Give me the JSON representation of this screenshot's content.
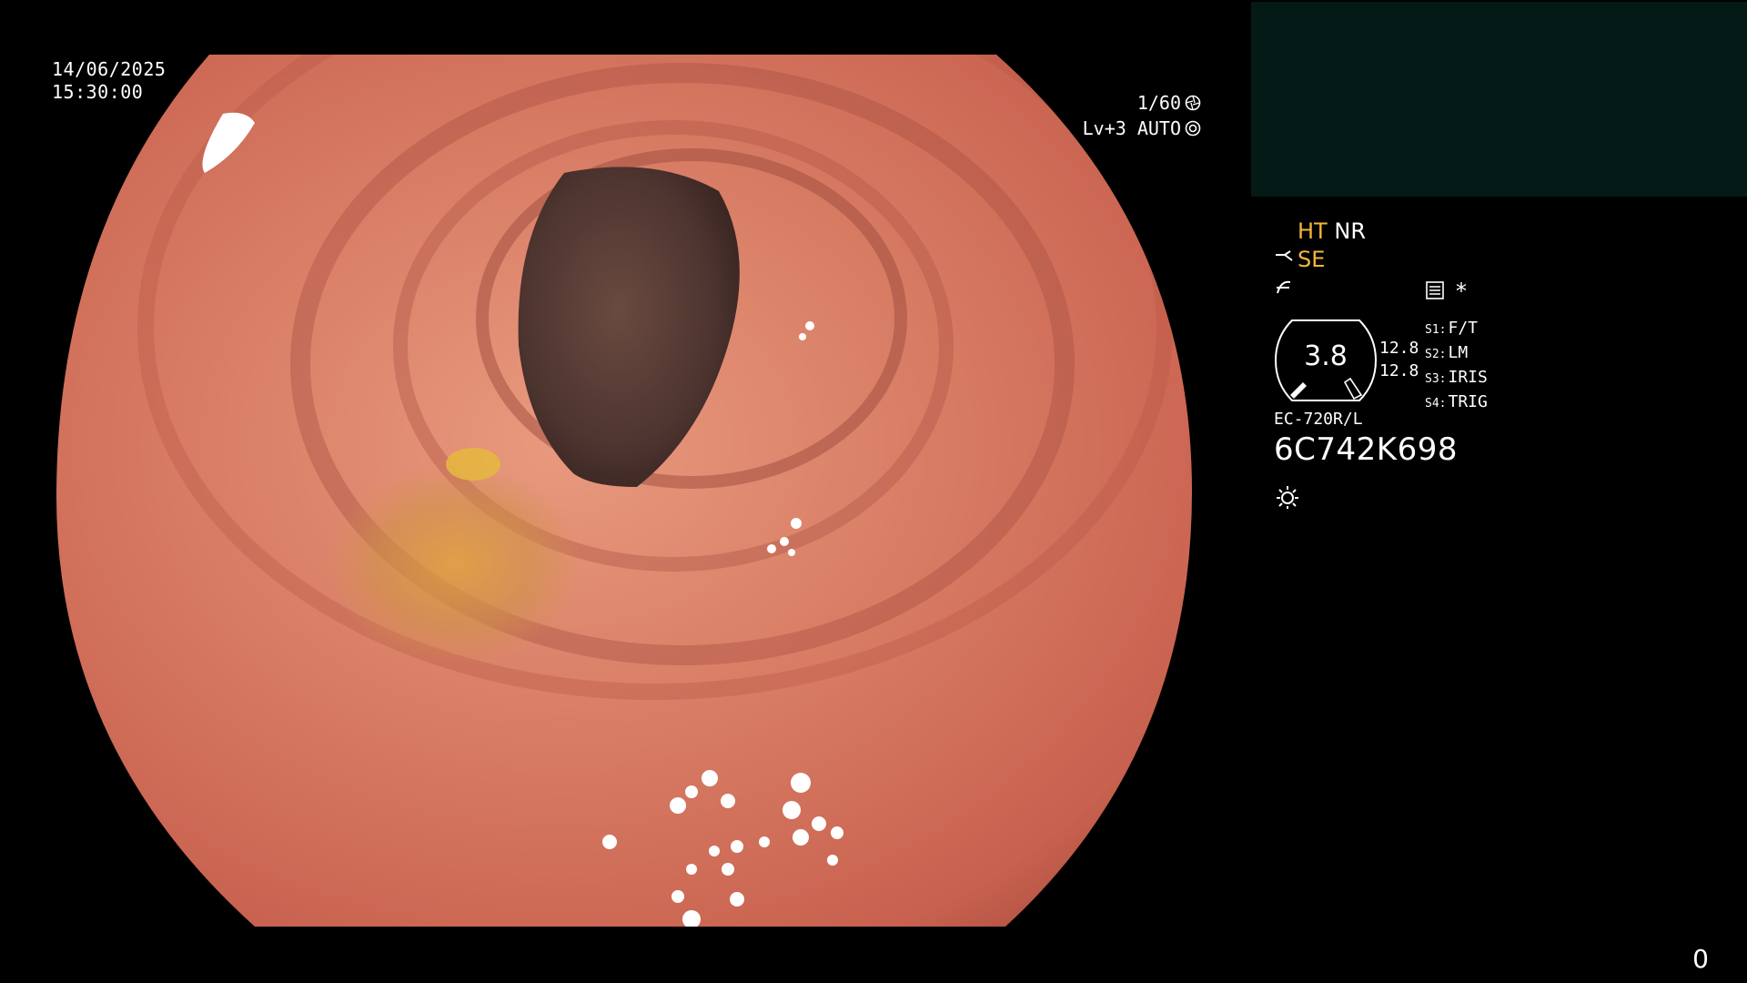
{
  "overlay": {
    "date": "14/06/2025",
    "time": "15:30:00",
    "shutter_speed": "1/60",
    "exposure": "Lv+3 AUTO"
  },
  "panel": {
    "mode1_a": "HT",
    "mode1_b": "NR",
    "mode2": "SE",
    "asterisk": "*",
    "zoom_value": "3.8",
    "dial_values": [
      "12.8",
      "12.8"
    ],
    "switches": [
      {
        "key": "S1:",
        "label": "F/T"
      },
      {
        "key": "S2:",
        "label": "LM"
      },
      {
        "key": "S3:",
        "label": "IRIS"
      },
      {
        "key": "S4:",
        "label": "TRIG"
      }
    ],
    "scope_model": "EC-720R/L",
    "serial": "6C742K698",
    "page_indicator": "0"
  },
  "colors": {
    "mode_highlight": "#f3b63b",
    "thumbnail_bg": "#041a17",
    "mucosa": "#d67a64",
    "lumen": "#5a3e36"
  },
  "icons": [
    "shutter-icon",
    "auto-iris-icon",
    "scope-tip-icon",
    "curve-icon",
    "menu-icon",
    "light-icon"
  ]
}
